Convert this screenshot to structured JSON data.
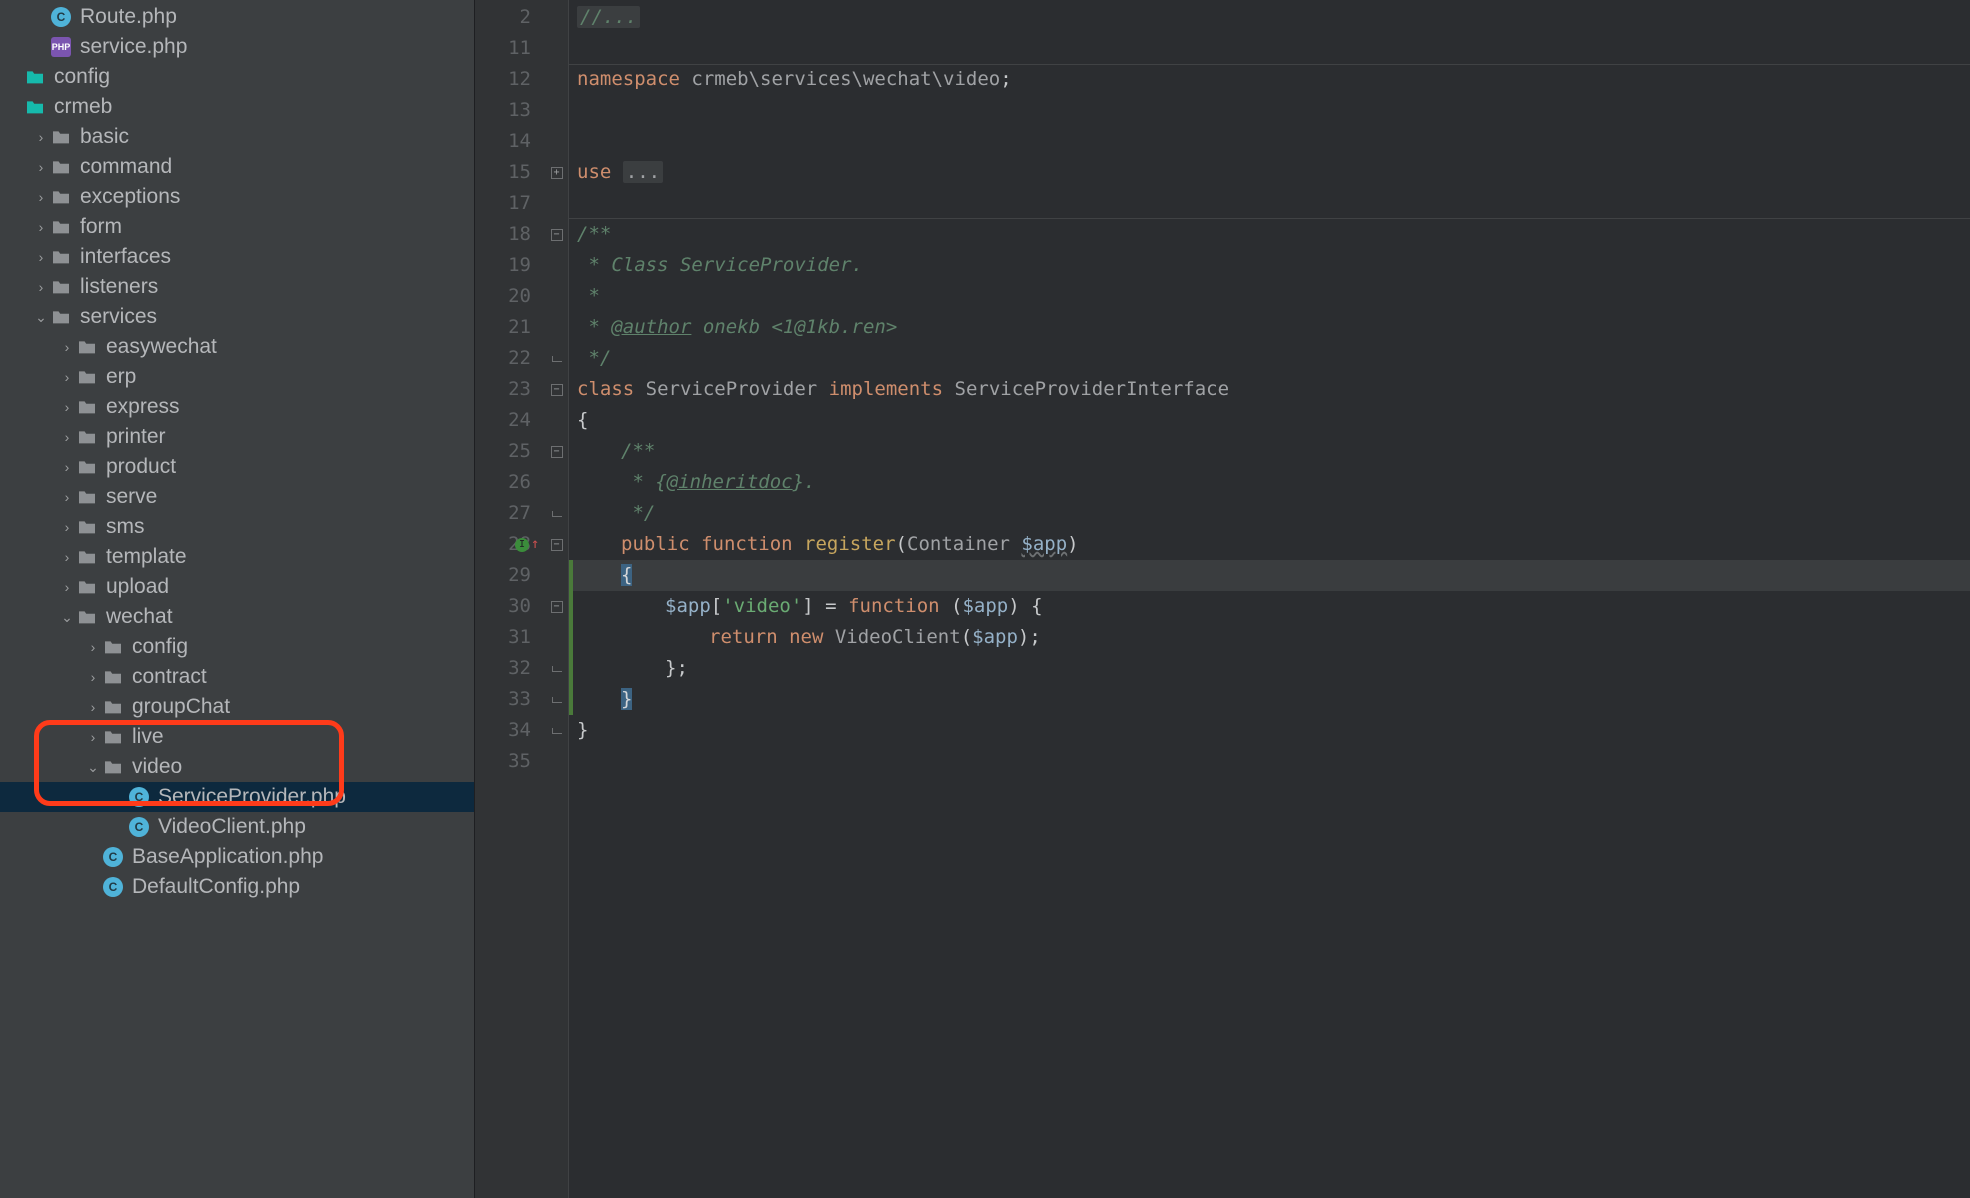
{
  "sidebar": {
    "items": [
      {
        "depth": 1,
        "arrow": "none",
        "icon": "phpclass",
        "label": "Route.php"
      },
      {
        "depth": 1,
        "arrow": "none",
        "icon": "phpfile",
        "label": "service.php"
      },
      {
        "depth": 0,
        "arrow": "none",
        "icon": "folder-teal",
        "label": "config"
      },
      {
        "depth": 0,
        "arrow": "none",
        "icon": "folder-teal",
        "label": "crmeb"
      },
      {
        "depth": 1,
        "arrow": "right",
        "icon": "folder",
        "label": "basic"
      },
      {
        "depth": 1,
        "arrow": "right",
        "icon": "folder",
        "label": "command"
      },
      {
        "depth": 1,
        "arrow": "right",
        "icon": "folder",
        "label": "exceptions"
      },
      {
        "depth": 1,
        "arrow": "right",
        "icon": "folder",
        "label": "form"
      },
      {
        "depth": 1,
        "arrow": "right",
        "icon": "folder",
        "label": "interfaces"
      },
      {
        "depth": 1,
        "arrow": "right",
        "icon": "folder",
        "label": "listeners"
      },
      {
        "depth": 1,
        "arrow": "down",
        "icon": "folder",
        "label": "services"
      },
      {
        "depth": 2,
        "arrow": "right",
        "icon": "folder",
        "label": "easywechat"
      },
      {
        "depth": 2,
        "arrow": "right",
        "icon": "folder",
        "label": "erp"
      },
      {
        "depth": 2,
        "arrow": "right",
        "icon": "folder",
        "label": "express"
      },
      {
        "depth": 2,
        "arrow": "right",
        "icon": "folder",
        "label": "printer"
      },
      {
        "depth": 2,
        "arrow": "right",
        "icon": "folder",
        "label": "product"
      },
      {
        "depth": 2,
        "arrow": "right",
        "icon": "folder",
        "label": "serve"
      },
      {
        "depth": 2,
        "arrow": "right",
        "icon": "folder",
        "label": "sms"
      },
      {
        "depth": 2,
        "arrow": "right",
        "icon": "folder",
        "label": "template"
      },
      {
        "depth": 2,
        "arrow": "right",
        "icon": "folder",
        "label": "upload"
      },
      {
        "depth": 2,
        "arrow": "down",
        "icon": "folder",
        "label": "wechat"
      },
      {
        "depth": 3,
        "arrow": "right",
        "icon": "folder",
        "label": "config"
      },
      {
        "depth": 3,
        "arrow": "right",
        "icon": "folder",
        "label": "contract"
      },
      {
        "depth": 3,
        "arrow": "right",
        "icon": "folder",
        "label": "groupChat"
      },
      {
        "depth": 3,
        "arrow": "right",
        "icon": "folder",
        "label": "live"
      },
      {
        "depth": 3,
        "arrow": "down",
        "icon": "folder",
        "label": "video"
      },
      {
        "depth": 4,
        "arrow": "none",
        "icon": "phpclass",
        "label": "ServiceProvider.php",
        "selected": true
      },
      {
        "depth": 4,
        "arrow": "none",
        "icon": "phpclass",
        "label": "VideoClient.php"
      },
      {
        "depth": 3,
        "arrow": "none",
        "icon": "phpclass",
        "label": "BaseApplication.php"
      },
      {
        "depth": 3,
        "arrow": "none",
        "icon": "phpclass",
        "label": "DefaultConfig.php"
      }
    ]
  },
  "editor": {
    "lines": [
      {
        "n": 2,
        "type": "folded",
        "parts": [
          {
            "t": "//...",
            "c": "com",
            "box": true
          }
        ]
      },
      {
        "n": 11,
        "parts": []
      },
      {
        "n": 12,
        "sep": "above",
        "parts": [
          {
            "t": "namespace ",
            "c": "kw"
          },
          {
            "t": "crmeb\\services\\wechat\\video",
            "c": "ns"
          },
          {
            "t": ";",
            "c": "brace"
          }
        ]
      },
      {
        "n": 13,
        "parts": []
      },
      {
        "n": 14,
        "parts": []
      },
      {
        "n": 15,
        "fold": "plus",
        "parts": [
          {
            "t": "use ",
            "c": "kw"
          },
          {
            "t": "...",
            "c": "ident",
            "box": true
          }
        ]
      },
      {
        "n": 17,
        "sep": "below",
        "parts": []
      },
      {
        "n": 18,
        "fold": "minus",
        "parts": [
          {
            "t": "/**",
            "c": "doc"
          }
        ]
      },
      {
        "n": 19,
        "parts": [
          {
            "t": " * Class ServiceProvider.",
            "c": "doc"
          }
        ]
      },
      {
        "n": 20,
        "parts": [
          {
            "t": " *",
            "c": "doc"
          }
        ]
      },
      {
        "n": 21,
        "parts": [
          {
            "t": " * ",
            "c": "doc"
          },
          {
            "t": "@author",
            "c": "doctag"
          },
          {
            "t": " onekb <1@1kb.ren>",
            "c": "doc"
          }
        ]
      },
      {
        "n": 22,
        "fold": "end",
        "parts": [
          {
            "t": " */",
            "c": "doc"
          }
        ]
      },
      {
        "n": 23,
        "fold": "minus",
        "parts": [
          {
            "t": "class ",
            "c": "kw"
          },
          {
            "t": "ServiceProvider ",
            "c": "ident"
          },
          {
            "t": "implements ",
            "c": "kw"
          },
          {
            "t": "ServiceProviderInterface",
            "c": "ident"
          }
        ]
      },
      {
        "n": 24,
        "parts": [
          {
            "t": "{",
            "c": "brace"
          }
        ]
      },
      {
        "n": 25,
        "fold": "minus",
        "indent": 1,
        "parts": [
          {
            "t": "/**",
            "c": "doc"
          }
        ]
      },
      {
        "n": 26,
        "indent": 1,
        "parts": [
          {
            "t": " * {",
            "c": "doc"
          },
          {
            "t": "@inheritdoc",
            "c": "doctag"
          },
          {
            "t": "}.",
            "c": "doc"
          }
        ]
      },
      {
        "n": 27,
        "fold": "end",
        "indent": 1,
        "parts": [
          {
            "t": " */",
            "c": "doc"
          }
        ]
      },
      {
        "n": 28,
        "fold": "minus",
        "indent": 1,
        "marker": "impl",
        "parts": [
          {
            "t": "public ",
            "c": "kw"
          },
          {
            "t": "function ",
            "c": "kw"
          },
          {
            "t": "register",
            "c": "fn"
          },
          {
            "t": "(",
            "c": "brace"
          },
          {
            "t": "Container ",
            "c": "type"
          },
          {
            "t": "$app",
            "c": "var",
            "warn": true
          },
          {
            "t": ")",
            "c": "brace"
          }
        ]
      },
      {
        "n": 29,
        "indent": 1,
        "cur": true,
        "green": true,
        "parts": [
          {
            "t": "{",
            "c": "brace",
            "bhl": true
          }
        ]
      },
      {
        "n": 30,
        "fold": "minus",
        "indent": 2,
        "green": true,
        "parts": [
          {
            "t": "$app",
            "c": "var"
          },
          {
            "t": "[",
            "c": "brace"
          },
          {
            "t": "'video'",
            "c": "str"
          },
          {
            "t": "] = ",
            "c": "brace"
          },
          {
            "t": "function ",
            "c": "kw"
          },
          {
            "t": "(",
            "c": "brace"
          },
          {
            "t": "$app",
            "c": "var"
          },
          {
            "t": ") {",
            "c": "brace"
          }
        ]
      },
      {
        "n": 31,
        "indent": 3,
        "green": true,
        "parts": [
          {
            "t": "return ",
            "c": "kw"
          },
          {
            "t": "new ",
            "c": "kw"
          },
          {
            "t": "VideoClient",
            "c": "ident"
          },
          {
            "t": "(",
            "c": "brace"
          },
          {
            "t": "$app",
            "c": "var"
          },
          {
            "t": ");",
            "c": "brace"
          }
        ]
      },
      {
        "n": 32,
        "fold": "end",
        "indent": 2,
        "green": true,
        "parts": [
          {
            "t": "};",
            "c": "brace"
          }
        ]
      },
      {
        "n": 33,
        "fold": "end",
        "indent": 1,
        "green": true,
        "parts": [
          {
            "t": "}",
            "c": "brace",
            "bhl": true
          }
        ]
      },
      {
        "n": 34,
        "fold": "end",
        "parts": [
          {
            "t": "}",
            "c": "brace"
          }
        ]
      },
      {
        "n": 35,
        "parts": []
      }
    ]
  }
}
